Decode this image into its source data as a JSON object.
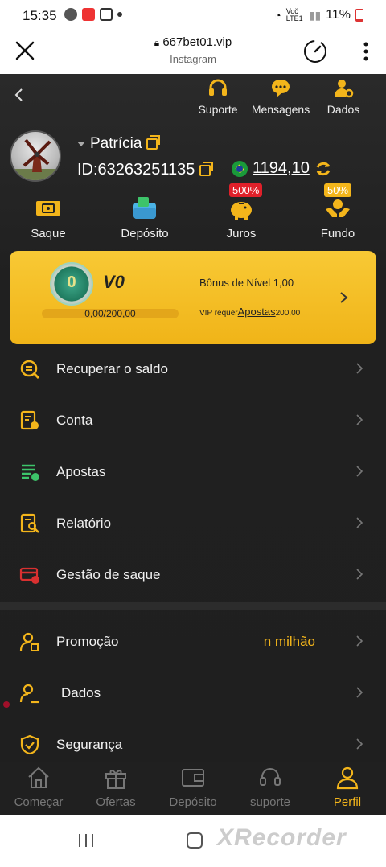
{
  "status_bar": {
    "time": "15:35",
    "battery": "11%",
    "network": "Voč LTE1"
  },
  "browser": {
    "url": "667bet01.vip",
    "subtitle": "Instagram"
  },
  "header_icons": [
    {
      "label": "Suporte",
      "icon": "headset-icon"
    },
    {
      "label": "Mensagens",
      "icon": "chat-icon"
    },
    {
      "label": "Dados",
      "icon": "user-gear-icon"
    }
  ],
  "profile": {
    "username": "Patrícia",
    "id_text": "ID:63263251135",
    "balance": "1194,10"
  },
  "actions": [
    {
      "label": "Saque",
      "icon": "ticket-icon"
    },
    {
      "label": "Depósito",
      "icon": "wallet-icon"
    },
    {
      "label": "Juros",
      "icon": "piggy-bank-icon",
      "badge": "500%"
    },
    {
      "label": "Fundo",
      "icon": "hands-coin-icon",
      "badge": "50%"
    }
  ],
  "vip": {
    "medal_value": "0",
    "level": "V0",
    "progress_text": "0,00/200,00",
    "progress": 0,
    "bonus_text": "Bônus de Nível 1,00",
    "req_prefix": "VIP requer",
    "req_link": "Apostas",
    "req_value": "200,00"
  },
  "menu": [
    {
      "label": "Recuperar o saldo",
      "icon": "coin-search-icon"
    },
    {
      "label": "Conta",
      "icon": "account-doc-icon"
    },
    {
      "label": "Apostas",
      "icon": "bets-list-icon"
    },
    {
      "label": "Relatório",
      "icon": "report-icon"
    },
    {
      "label": "Gestão de saque",
      "icon": "withdraw-card-icon"
    },
    {
      "label": "Promoção",
      "icon": "promo-user-icon",
      "extra": "n milhão"
    },
    {
      "label": "Dados",
      "icon": "user-edit-icon"
    },
    {
      "label": "Segurança",
      "icon": "shield-check-icon"
    }
  ],
  "bottom_nav": [
    {
      "label": "Começar",
      "icon": "home-icon"
    },
    {
      "label": "Ofertas",
      "icon": "gift-icon"
    },
    {
      "label": "Depósito",
      "icon": "wallet-icon"
    },
    {
      "label": "suporte",
      "icon": "headset-icon"
    },
    {
      "label": "Perfil",
      "icon": "person-icon",
      "active": true
    }
  ],
  "watermark": "XRecorder",
  "colors": {
    "accent": "#f3b51b",
    "background": "#1e1e1e",
    "vip_card": "#f5c028",
    "badge_red": "#e0202a"
  }
}
